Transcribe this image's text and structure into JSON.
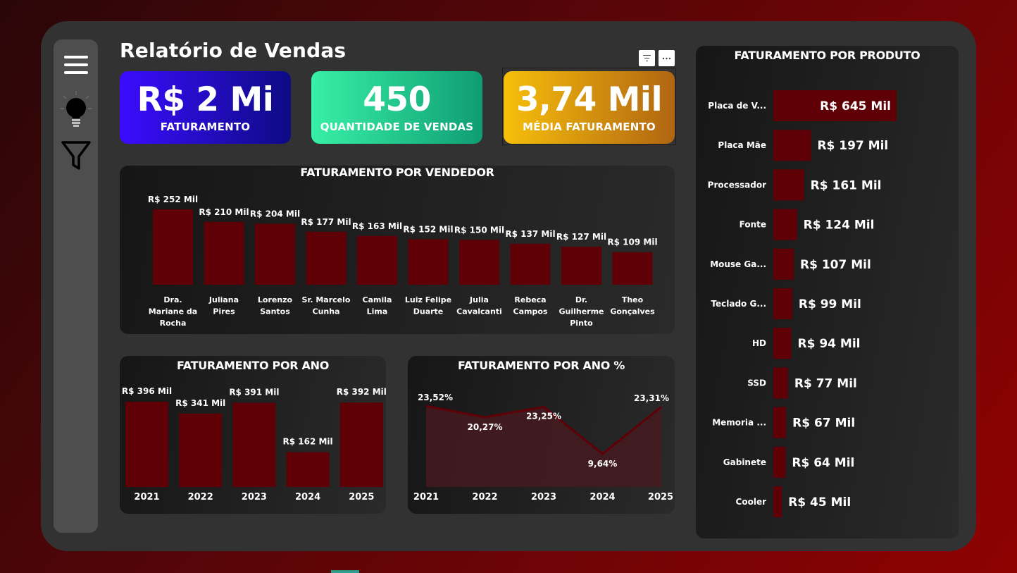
{
  "header": {
    "title": "Relatório de Vendas"
  },
  "sidebar": {
    "items": [
      {
        "icon": "menu-icon"
      },
      {
        "icon": "lightbulb-icon"
      },
      {
        "icon": "filter-icon"
      }
    ]
  },
  "visual_tools": [
    {
      "icon": "filter-lines-icon"
    },
    {
      "icon": "more-options-icon"
    }
  ],
  "kpis": [
    {
      "value": "R$ 2 Mi",
      "label": "FATURAMENTO",
      "colors": [
        "#3b0cff",
        "#0d0b84"
      ]
    },
    {
      "value": "450",
      "label": "QUANTIDADE DE VENDAS",
      "colors": [
        "#38f0a6",
        "#0f9d73"
      ]
    },
    {
      "value": "3,74 Mil",
      "label": "MÉDIA FATURAMENTO",
      "colors": [
        "#f7bf0b",
        "#b06512"
      ]
    }
  ],
  "colors": {
    "bar": "#5f0007",
    "line": "#5f0007",
    "area": "#451a1e",
    "text": "#ffffff"
  },
  "charts": {
    "vendedor": {
      "title": "FATURAMENTO POR VENDEDOR"
    },
    "ano": {
      "title": "FATURAMENTO POR ANO"
    },
    "ano_pct": {
      "title": "FATURAMENTO POR ANO %"
    },
    "produto": {
      "title": "FATURAMENTO POR PRODUTO"
    }
  },
  "chart_data": [
    {
      "type": "bar",
      "title": "FATURAMENTO POR VENDEDOR",
      "categories": [
        [
          "Dra.",
          "Mariane da",
          "Rocha"
        ],
        [
          "Juliana",
          "Pires"
        ],
        [
          "Lorenzo",
          "Santos"
        ],
        [
          "Sr. Marcelo",
          "Cunha"
        ],
        [
          "Camila",
          "Lima"
        ],
        [
          "Luiz Felipe",
          "Duarte"
        ],
        [
          "Julia",
          "Cavalcanti"
        ],
        [
          "Rebeca",
          "Campos"
        ],
        [
          "Dr.",
          "Guilherme",
          "Pinto"
        ],
        [
          "Theo",
          "Gonçalves"
        ]
      ],
      "values": [
        252,
        210,
        204,
        177,
        163,
        152,
        150,
        137,
        127,
        109
      ],
      "labels": [
        "R$ 252 Mil",
        "R$ 210 Mil",
        "R$ 204 Mil",
        "R$ 177 Mil",
        "R$ 163 Mil",
        "R$ 152 Mil",
        "R$ 150 Mil",
        "R$ 137 Mil",
        "R$ 127 Mil",
        "R$ 109 Mil"
      ],
      "ylim": [
        0,
        252
      ]
    },
    {
      "type": "bar",
      "title": "FATURAMENTO POR ANO",
      "categories": [
        "2021",
        "2022",
        "2023",
        "2024",
        "2025"
      ],
      "values": [
        396,
        341,
        391,
        162,
        392
      ],
      "labels": [
        "R$ 396 Mil",
        "R$ 341 Mil",
        "R$ 391 Mil",
        "R$ 162 Mil",
        "R$ 392 Mil"
      ],
      "ylim": [
        0,
        396
      ]
    },
    {
      "type": "area",
      "title": "FATURAMENTO POR ANO %",
      "categories": [
        "2021",
        "2022",
        "2023",
        "2024",
        "2025"
      ],
      "values": [
        23.52,
        20.27,
        23.25,
        9.64,
        23.31
      ],
      "labels": [
        "23,52%",
        "20,27%",
        "23,25%",
        "9,64%",
        "23,31%"
      ]
    },
    {
      "type": "bar",
      "orientation": "horizontal",
      "title": "FATURAMENTO POR PRODUTO",
      "categories": [
        "Placa de V...",
        "Placa Mãe",
        "Processador",
        "Fonte",
        "Mouse Ga...",
        "Teclado G...",
        "HD",
        "SSD",
        "Memoria ...",
        "Gabinete",
        "Cooler"
      ],
      "values": [
        645,
        197,
        161,
        124,
        107,
        99,
        94,
        77,
        67,
        64,
        45
      ],
      "labels": [
        "R$ 645 Mil",
        "R$ 197 Mil",
        "R$ 161 Mil",
        "R$ 124 Mil",
        "R$ 107 Mil",
        "R$ 99 Mil",
        "R$ 94 Mil",
        "R$ 77 Mil",
        "R$ 67 Mil",
        "R$ 64 Mil",
        "R$ 45 Mil"
      ],
      "xlim": [
        0,
        645
      ]
    }
  ]
}
